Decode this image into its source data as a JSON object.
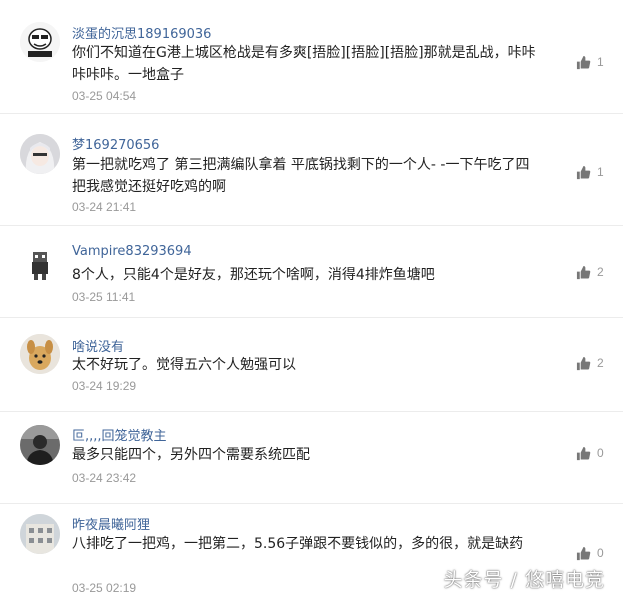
{
  "comments": [
    {
      "username": "淡蛋的沉思189169036",
      "text": "你们不知道在G港上城区枪战是有多爽[捂脸][捂脸][捂脸]那就是乱战，咔咔咔咔咔。一地盒子",
      "time": "03-25 04:54",
      "likes": "1",
      "avatar": "meme-avatar"
    },
    {
      "username": "梦169270656",
      "text": "第一把就吃鸡了 第三把满编队拿着 平底锅找剩下的一个人- -一下午吃了四把我感觉还挺好吃鸡的啊",
      "time": "03-24 21:41",
      "likes": "1",
      "avatar": "anime-girl-avatar"
    },
    {
      "username": "Vampire83293694",
      "text": "8个人，只能4个是好友，那还玩个啥啊，消得4排炸鱼塘吧",
      "time": "03-25 11:41",
      "likes": "2",
      "avatar": "pixel-character-avatar"
    },
    {
      "username": "啥说没有",
      "text": "太不好玩了。觉得五六个人勉强可以",
      "time": "03-24 19:29",
      "likes": "2",
      "avatar": "dog-avatar"
    },
    {
      "username": "叵,,,,回笼觉教主",
      "text": "最多只能四个，另外四个需要系统匹配",
      "time": "03-24 23:42",
      "likes": "0",
      "avatar": "dark-photo-avatar"
    },
    {
      "username": "昨夜晨曦阿狸",
      "text": "八排吃了一把鸡，一把第二，5.56子弹跟不要钱似的，多的很，就是缺药",
      "time": "03-25 02:19",
      "likes": "0",
      "avatar": "building-photo-avatar"
    }
  ],
  "watermark": "头条号 / 悠嘻电竞",
  "colors": {
    "username": "#406599",
    "text": "#222222",
    "meta": "#999999"
  }
}
